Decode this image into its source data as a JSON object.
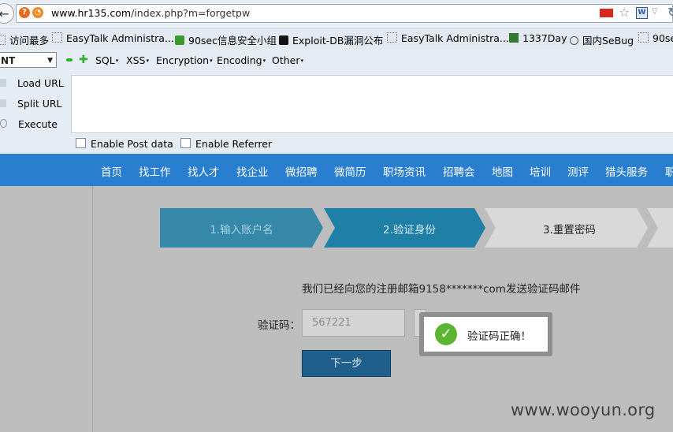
{
  "browser": {
    "url_host": "www.hr135.com",
    "url_path": "/index.php?m=forgetpw"
  },
  "bookmarks": [
    {
      "label": "访问最多",
      "icon": "dotted-page-icon"
    },
    {
      "label": "EasyTalk Administra...",
      "icon": "dotted-page-icon"
    },
    {
      "label": "90sec信息安全小组",
      "icon": "green-logo-icon"
    },
    {
      "label": "Exploit-DB漏洞公布",
      "icon": "exploit-db-icon"
    },
    {
      "label": "EasyTalk Administra...",
      "icon": "dotted-page-icon"
    },
    {
      "label": "1337Day",
      "icon": "1337day-icon"
    },
    {
      "label": "国内SeBug",
      "icon": "power-icon"
    },
    {
      "label": "90se",
      "icon": "dotted-page-icon"
    }
  ],
  "hackbar": {
    "select_value": "NT",
    "menus": [
      "SQL",
      "XSS",
      "Encryption",
      "Encoding",
      "Other"
    ],
    "load_url": "Load URL",
    "split_url": "Split URL",
    "execute": "Execute",
    "enable_post": "Enable Post data",
    "enable_referrer": "Enable Referrer"
  },
  "site_nav": [
    "首页",
    "找工作",
    "找人才",
    "找企业",
    "微招聘",
    "微简历",
    "职场资讯",
    "招聘会",
    "地图",
    "培训",
    "测评",
    "猎头服务",
    "职"
  ],
  "steps": [
    "1.输入账户名",
    "2.验证身份",
    "3.重置密码"
  ],
  "form": {
    "notice": "我们已经向您的注册邮箱9158*******com发送验证码邮件",
    "code_label": "验证码：",
    "code_value": "567221",
    "next_button": "下一步"
  },
  "toast": {
    "message": "验证码正确！"
  },
  "watermark": "www.wooyun.org",
  "colors": {
    "nav_blue": "#2a7ed0",
    "step_active": "#1f7fa6",
    "step_inactive": "#d9d9d9",
    "toast_green": "#5cb531"
  }
}
